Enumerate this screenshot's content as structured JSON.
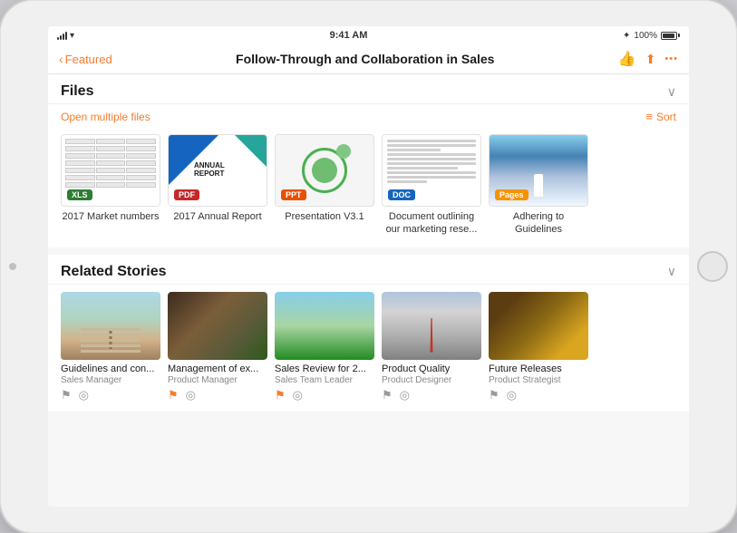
{
  "device": {
    "status_bar": {
      "time": "9:41 AM",
      "signal": "●●●",
      "wifi": "wifi",
      "battery_pct": "100%",
      "bluetooth": "BT"
    }
  },
  "nav": {
    "back_label": "Featured",
    "title": "Follow-Through and Collaboration in Sales",
    "like_icon": "thumbs-up",
    "share_icon": "share",
    "more_icon": "more"
  },
  "files_section": {
    "title": "Files",
    "open_multiple_label": "Open multiple files",
    "sort_label": "Sort",
    "files": [
      {
        "id": "f1",
        "name": "2017 Market numbers",
        "badge": "XLS",
        "type": "xls"
      },
      {
        "id": "f2",
        "name": "2017 Annual Report",
        "badge": "PDF",
        "type": "pdf"
      },
      {
        "id": "f3",
        "name": "Presentation V3.1",
        "badge": "PPT",
        "type": "ppt"
      },
      {
        "id": "f4",
        "name": "Document outlining our marketing rese...",
        "badge": "DOC",
        "type": "doc"
      },
      {
        "id": "f5",
        "name": "Adhering to Guidelines",
        "badge": "Pages",
        "type": "pages"
      }
    ]
  },
  "related_section": {
    "title": "Related Stories",
    "stories": [
      {
        "id": "s1",
        "name": "Guidelines and con...",
        "role": "Sales Manager",
        "bookmarked": false,
        "rss": false,
        "thumb": "beach"
      },
      {
        "id": "s2",
        "name": "Management of ex...",
        "role": "Product Manager",
        "bookmarked": true,
        "rss": false,
        "thumb": "tech"
      },
      {
        "id": "s3",
        "name": "Sales Review for 2...",
        "role": "Sales Team Leader",
        "bookmarked": true,
        "rss": false,
        "thumb": "field"
      },
      {
        "id": "s4",
        "name": "Product Quality",
        "role": "Product Designer",
        "bookmarked": false,
        "rss": false,
        "thumb": "city"
      },
      {
        "id": "s5",
        "name": "Future Releases",
        "role": "Product Strategist",
        "bookmarked": false,
        "rss": false,
        "thumb": "fruit"
      }
    ]
  }
}
